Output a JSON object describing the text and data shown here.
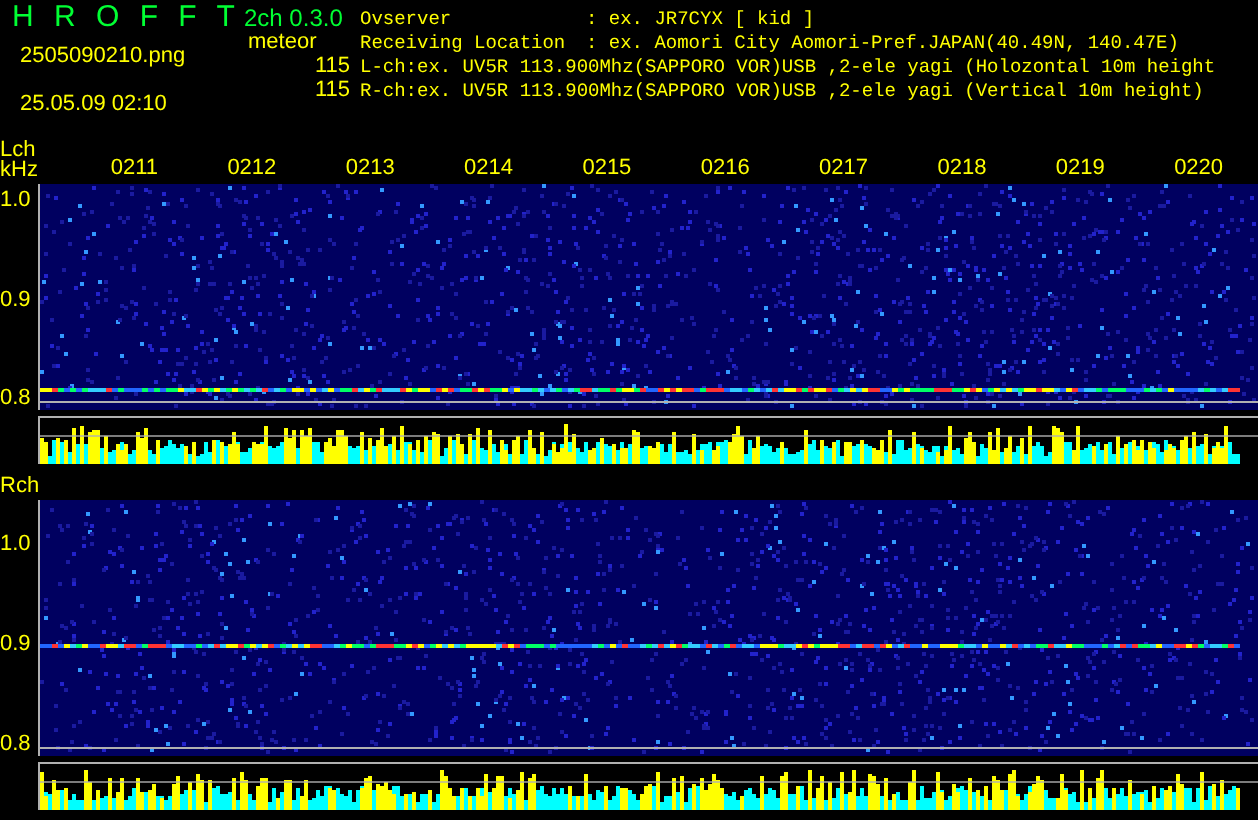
{
  "app": {
    "title": "H R O F F T",
    "version": "2ch 0.3.0",
    "filename": "2505090210.png",
    "timestamp": "25.05.09 02:10",
    "counter_label": "meteor",
    "counts": [
      "115",
      "115"
    ]
  },
  "info": [
    {
      "label": "Ovserver",
      "value": ": ex. JR7CYX [ kid ]"
    },
    {
      "label": "Receiving Location",
      "value": ": ex. Aomori City Aomori-Pref.JAPAN(40.49N, 140.47E)"
    },
    {
      "text": "L-ch:ex. UV5R 113.900Mhz(SAPPORO VOR)USB ,2-ele yagi (Holozontal 10m height"
    },
    {
      "text": "R-ch:ex. UV5R 113.900Mhz(SAPPORO VOR)USB ,2-ele yagi (Vertical 10m height)"
    }
  ],
  "channels": [
    {
      "label": "Lch",
      "unit": "kHz",
      "time_labels": [
        "0211",
        "0212",
        "0213",
        "0214",
        "0215",
        "0216",
        "0217",
        "0218",
        "0219",
        "0220"
      ],
      "freq_labels": [
        "1.0",
        "0.9",
        "0.8"
      ]
    },
    {
      "label": "Rch",
      "freq_labels": [
        "1.0",
        "0.9",
        "0.8"
      ]
    }
  ]
}
